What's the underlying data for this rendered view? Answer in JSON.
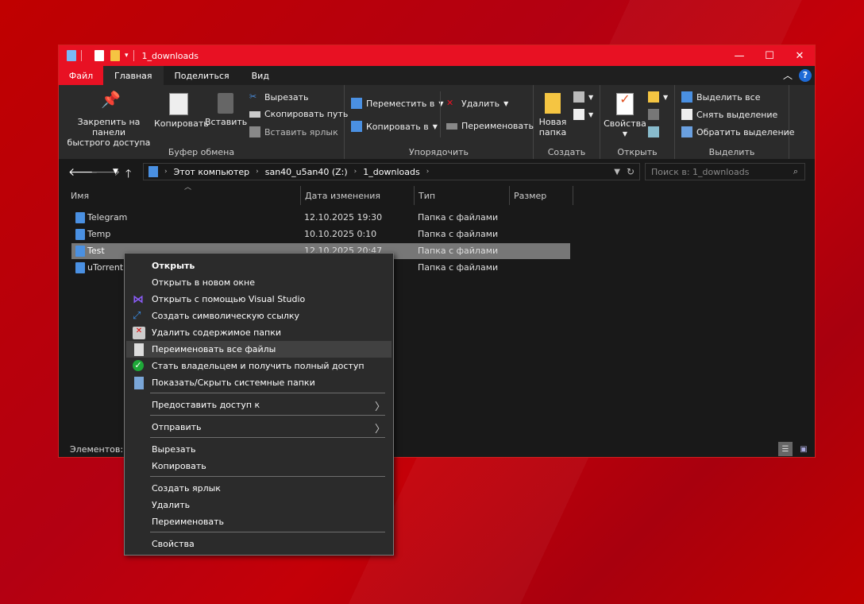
{
  "window": {
    "title": "1_downloads",
    "buttons": {
      "minimize": "—",
      "maximize": "☐",
      "close": "✕"
    }
  },
  "menubar": {
    "tabs": [
      "Файл",
      "Главная",
      "Поделиться",
      "Вид"
    ],
    "help": "?"
  },
  "ribbon": {
    "clipboard": {
      "pin_label_1": "Закрепить на панели",
      "pin_label_2": "быстрого доступа",
      "copy": "Копировать",
      "paste": "Вставить",
      "cut": "Вырезать",
      "copy_path": "Скопировать путь",
      "paste_shortcut": "Вставить ярлык",
      "group": "Буфер обмена"
    },
    "organize": {
      "move_to": "Переместить в",
      "copy_to": "Копировать в",
      "delete": "Удалить",
      "rename": "Переименовать",
      "group": "Упорядочить"
    },
    "new": {
      "new_folder_1": "Новая",
      "new_folder_2": "папка",
      "group": "Создать"
    },
    "open": {
      "properties": "Свойства",
      "group": "Открыть"
    },
    "select": {
      "select_all": "Выделить все",
      "select_none": "Снять выделение",
      "invert": "Обратить выделение",
      "group": "Выделить"
    }
  },
  "address": {
    "crumbs": [
      "Этот компьютер",
      "san40_u5an40 (Z:)",
      "1_downloads"
    ],
    "search_placeholder": "Поиск в: 1_downloads"
  },
  "columns": [
    "Имя",
    "Дата изменения",
    "Тип",
    "Размер"
  ],
  "files": [
    {
      "name": "Telegram",
      "date": "12.10.2025 19:30",
      "type": "Папка с файлами"
    },
    {
      "name": "Temp",
      "date": "10.10.2025 0:10",
      "type": "Папка с файлами"
    },
    {
      "name": "Test",
      "date": "12.10.2025 20:47",
      "type": "Папка с файлами"
    },
    {
      "name": "uTorrent",
      "date": "",
      "type": "Папка с файлами"
    }
  ],
  "status": {
    "items": "Элементов: 4"
  },
  "context_menu": {
    "open": "Открыть",
    "open_new_window": "Открыть в новом окне",
    "open_vs": "Открыть с помощью Visual Studio",
    "symlink": "Создать символическую ссылку",
    "delete_contents": "Удалить содержимое папки",
    "rename_all": "Переименовать все файлы",
    "take_ownership": "Стать владельцем и получить полный доступ",
    "toggle_system": "Показать/Скрыть системные папки",
    "share_with": "Предоставить доступ к",
    "send_to": "Отправить",
    "cut": "Вырезать",
    "copy": "Копировать",
    "create_shortcut": "Создать ярлык",
    "delete": "Удалить",
    "rename": "Переименовать",
    "properties": "Свойства"
  },
  "colors": {
    "accent": "#e81123",
    "window_bg": "#191919",
    "ribbon_bg": "#2b2b2b",
    "selection": "#777777"
  }
}
